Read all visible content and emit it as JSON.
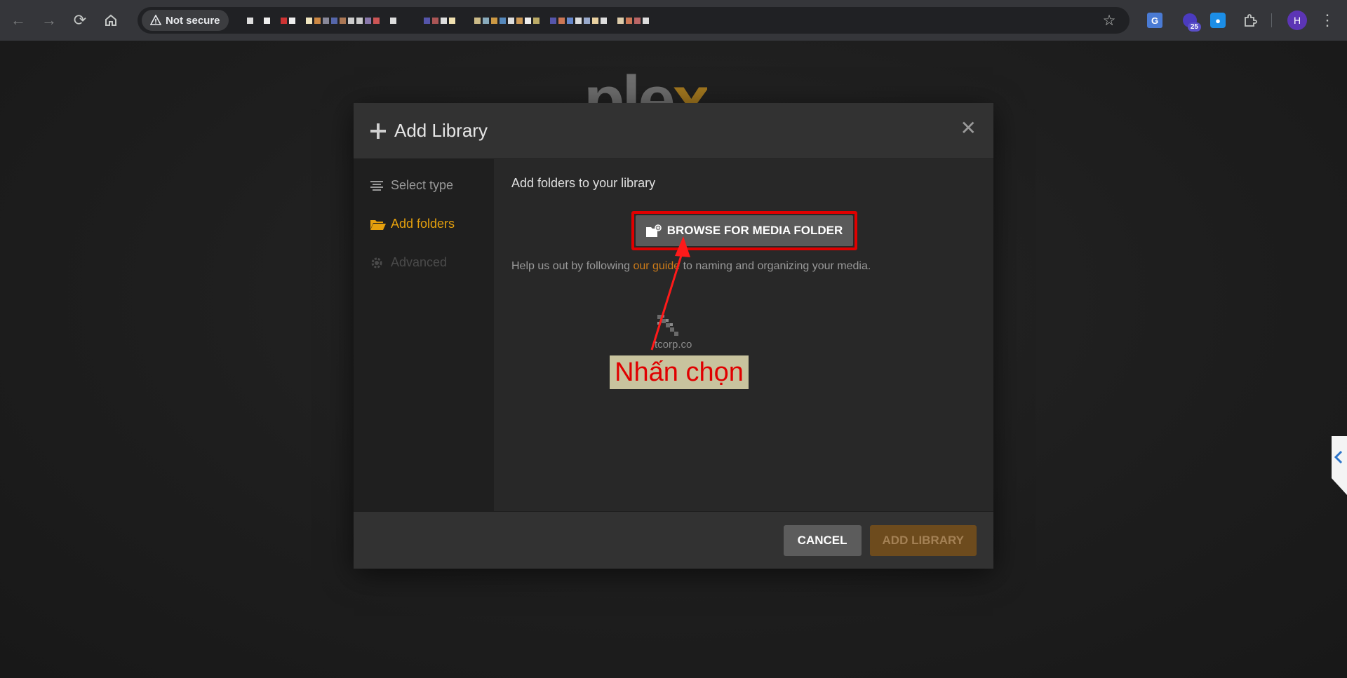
{
  "browser": {
    "security_label": "Not secure",
    "profile_initial": "H",
    "extension_badge": "25"
  },
  "page": {
    "logo_text": "ple",
    "logo_accent": "x"
  },
  "dialog": {
    "title": "Add Library",
    "sidebar": {
      "items": [
        {
          "label": "Select type",
          "state": "done"
        },
        {
          "label": "Add folders",
          "state": "active"
        },
        {
          "label": "Advanced",
          "state": "disabled"
        }
      ]
    },
    "content": {
      "heading": "Add folders to your library",
      "browse_label": "BROWSE FOR MEDIA FOLDER",
      "help_prefix": "Help us out by following ",
      "help_link": "our guide",
      "help_suffix": " to naming and organizing your media."
    },
    "footer": {
      "cancel_label": "CANCEL",
      "add_label": "ADD LIBRARY"
    }
  },
  "annotation": {
    "label": "Nhấn chọn",
    "watermark": "tcorp.co"
  },
  "colors": {
    "accent": "#e5a00d",
    "link": "#cc7b19",
    "highlight": "#e00000"
  }
}
